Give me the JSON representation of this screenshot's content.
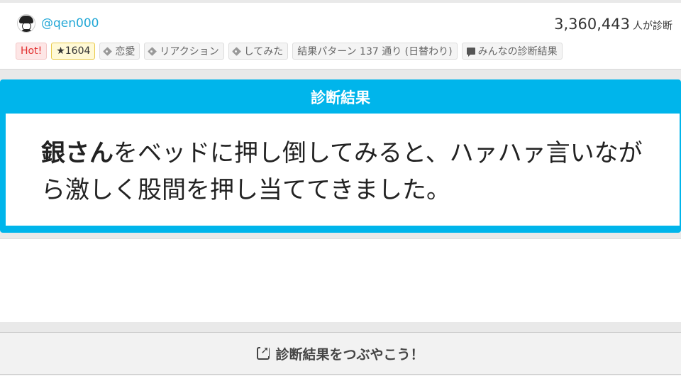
{
  "author": {
    "handle": "@qen000"
  },
  "diagnosis_count": {
    "number": "3,360,443",
    "unit": "人が診断"
  },
  "tags": {
    "hot": "Hot!",
    "favorites": "★1604",
    "items": [
      "恋愛",
      "リアクション",
      "してみた"
    ],
    "patterns": "結果パターン 137 通り (日替わり)",
    "everyone": "みんなの診断結果"
  },
  "result": {
    "title": "診断結果",
    "name": "銀さん",
    "text": "をベッドに押し倒してみると、ハァハァ言いながら激しく股間を押し当ててきました。"
  },
  "share": {
    "label": "診断結果をつぶやこう！"
  },
  "colors": {
    "accent": "#00b5eb",
    "link": "#21a7d6",
    "hot": "#e22e2e"
  }
}
